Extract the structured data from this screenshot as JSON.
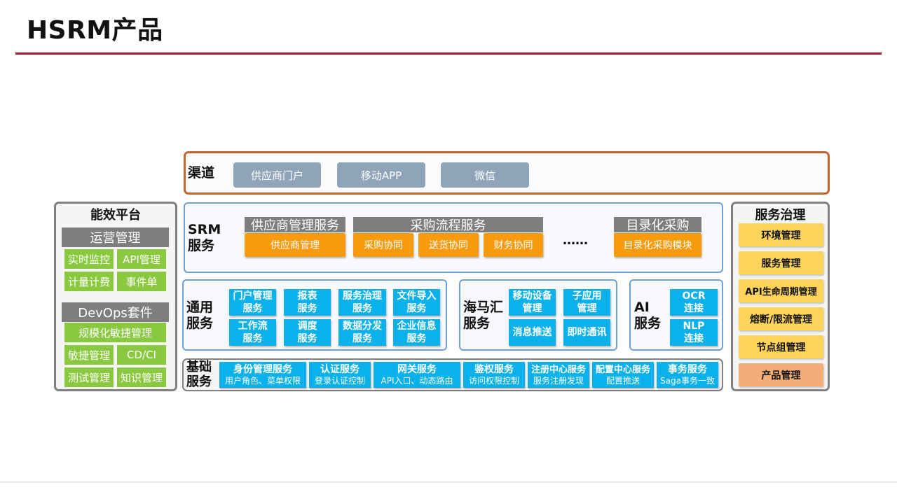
{
  "page": {
    "title": "HSRM产品"
  },
  "channels": {
    "label": "渠道",
    "items": [
      "供应商门户",
      "移动APP",
      "微信"
    ]
  },
  "srm": {
    "label": "SRM\n服务",
    "groups": [
      {
        "header": "供应商管理服务",
        "items": [
          "供应商管理"
        ]
      },
      {
        "header": "采购流程服务",
        "items": [
          "采购协同",
          "送货协同",
          "财务协同"
        ]
      },
      {
        "header": "目录化采购",
        "items": [
          "目录化采购模块"
        ]
      }
    ],
    "ellipsis": "……"
  },
  "common": {
    "label": "通用\n服务",
    "items": [
      "门户管理\n服务",
      "报表\n服务",
      "服务治理\n服务",
      "文件导入\n服务",
      "工作流\n服务",
      "调度\n服务",
      "数据分发\n服务",
      "企业信息\n服务"
    ]
  },
  "haimahui": {
    "label": "海马汇\n服务",
    "items": [
      "移动设备\n管理",
      "子应用\n管理",
      "消息推送",
      "即时通讯"
    ]
  },
  "ai": {
    "label": "AI\n服务",
    "items": [
      "OCR\n连接",
      "NLP\n连接"
    ]
  },
  "base": {
    "label": "基础\n服务",
    "items": [
      {
        "title": "身份管理服务",
        "sub": "用户角色、菜单权限"
      },
      {
        "title": "认证服务",
        "sub": "登录认证控制"
      },
      {
        "title": "网关服务",
        "sub": "API入口、动态路由"
      },
      {
        "title": "鉴权服务",
        "sub": "访问权限控制"
      },
      {
        "title": "注册中心服务",
        "sub": "服务注册发现"
      },
      {
        "title": "配置中心服务",
        "sub": "配置推送"
      },
      {
        "title": "事务服务",
        "sub": "Saga事务一致"
      }
    ]
  },
  "efficiency": {
    "title": "能效平台",
    "ops": {
      "header": "运营管理",
      "items": [
        "实时监控",
        "API管理",
        "计量计费",
        "事件单"
      ]
    },
    "devops": {
      "header": "DevOps套件",
      "wide": "规模化敏捷管理",
      "items": [
        "敏捷管理",
        "CD/CI",
        "测试管理",
        "知识管理"
      ]
    }
  },
  "governance": {
    "title": "服务治理",
    "items": [
      "环境管理",
      "服务管理",
      "API生命周期管理",
      "熔断/限流管理",
      "节点组管理"
    ],
    "last": "产品管理"
  }
}
